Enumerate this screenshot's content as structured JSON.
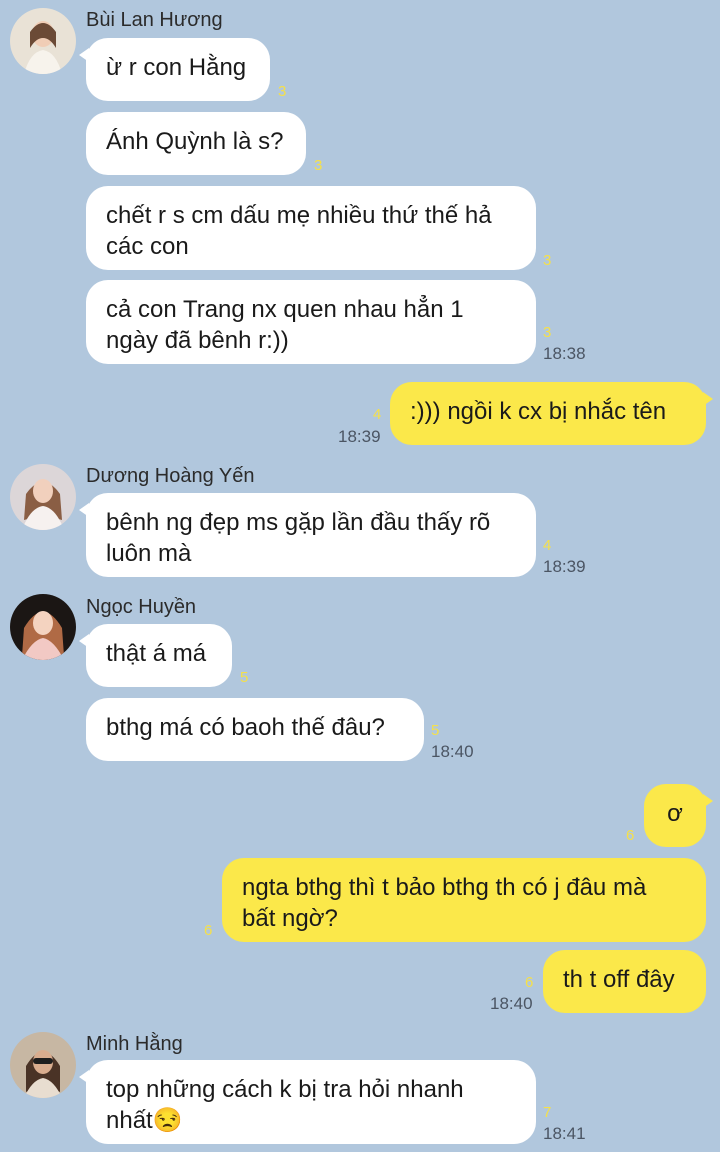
{
  "messages": {
    "s1": {
      "name": "Bùi Lan Hương",
      "avatar": "avatar-photo"
    },
    "m1": {
      "text": "ừ r con Hằng",
      "count": "3"
    },
    "m2": {
      "text": "Ánh Quỳnh là s?",
      "count": "3"
    },
    "m3": {
      "text": "chết r s cm dấu mẹ nhiều thứ thế hả\ncác con",
      "count": "3"
    },
    "m4": {
      "text": "cả con Trang nx quen nhau hẳn 1\nngày đã bênh r:))",
      "count": "3",
      "time": "18:38"
    },
    "m5": {
      "text": ":))) ngồi k cx bị nhắc tên",
      "count": "4",
      "time": "18:39"
    },
    "s2": {
      "name": "Dương Hoàng Yến",
      "avatar": "avatar-photo"
    },
    "m6": {
      "text": "bênh ng đẹp ms gặp lần đầu thấy rõ\nluôn mà",
      "count": "4",
      "time": "18:39"
    },
    "s3": {
      "name": "Ngọc Huyền",
      "avatar": "avatar-photo"
    },
    "m7": {
      "text": "thật á má",
      "count": "5"
    },
    "m8": {
      "text": "bthg má có baoh thế đâu?",
      "count": "5",
      "time": "18:40"
    },
    "m9": {
      "text": "ơ",
      "count": "6"
    },
    "m10": {
      "text": "ngta bthg thì t bảo bthg th có j đâu mà\nbất ngờ?",
      "count": "6"
    },
    "m11": {
      "text": "th t off đây",
      "count": "6",
      "time": "18:40"
    },
    "s4": {
      "name": "Minh Hằng",
      "avatar": "avatar-photo"
    },
    "m12": {
      "text": "top những cách k bị tra hỏi nhanh\nnhất😒",
      "count": "7",
      "time": "18:41"
    }
  },
  "colors": {
    "background": "#b1c7dd",
    "incoming_bubble": "#ffffff",
    "outgoing_bubble": "#fbe84a",
    "unread_count": "#f5e04a",
    "timestamp": "#4b5563"
  }
}
